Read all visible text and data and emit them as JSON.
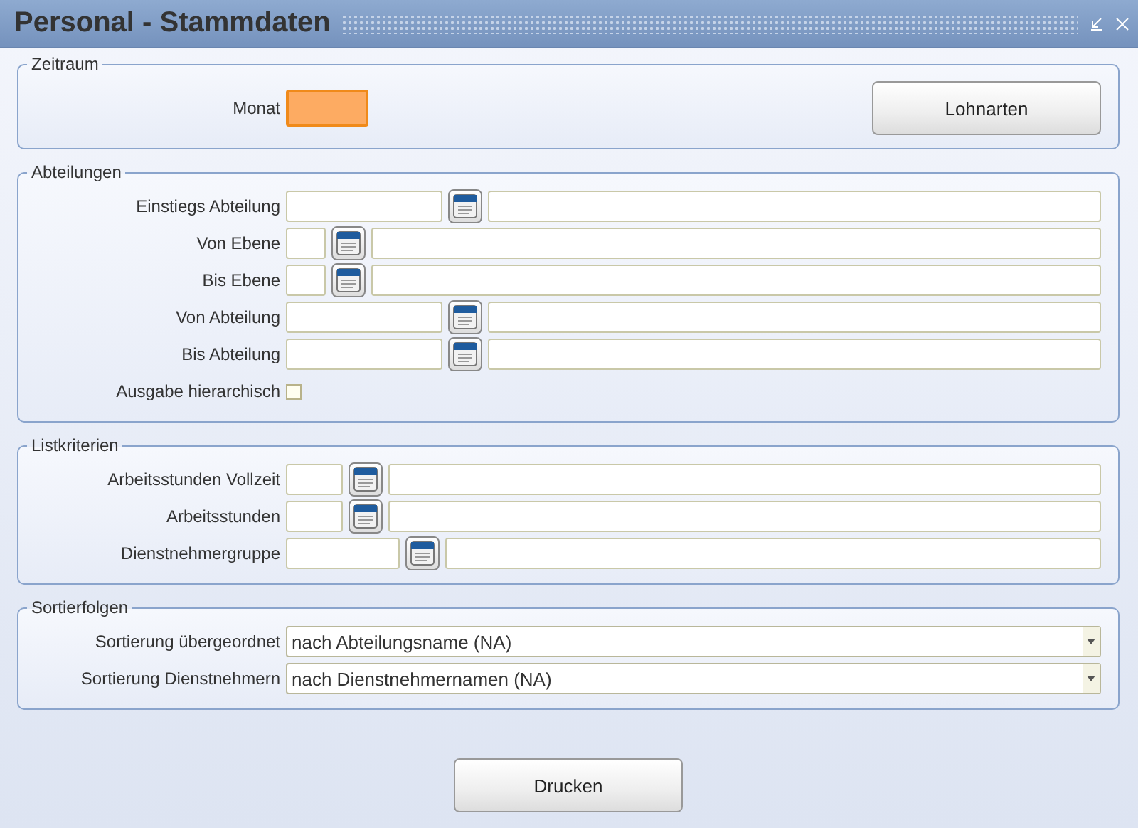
{
  "window": {
    "title": "Personal - Stammdaten"
  },
  "zeitraum": {
    "legend": "Zeitraum",
    "monat": {
      "label": "Monat",
      "focused": true
    },
    "button": "Lohnarten"
  },
  "abteilungen": {
    "legend": "Abteilungen",
    "rows": [
      {
        "label": "Einstiegs Abteilung",
        "kind": "lookup"
      },
      {
        "label": "Von Ebene",
        "kind": "lookup"
      },
      {
        "label": "Bis Ebene",
        "kind": "lookup"
      },
      {
        "label": "Von Abteilung",
        "kind": "lookup"
      },
      {
        "label": "Bis Abteilung",
        "kind": "lookup"
      },
      {
        "label": "Ausgabe hierarchisch",
        "kind": "checkbox",
        "checked": false
      }
    ]
  },
  "listkriterien": {
    "legend": "Listkriterien",
    "rows": [
      {
        "label": "Arbeitsstunden Vollzeit",
        "kind": "lookup"
      },
      {
        "label": "Arbeitsstunden",
        "kind": "lookup"
      },
      {
        "label": "Dienstnehmergruppe",
        "kind": "lookup"
      }
    ]
  },
  "sortierfolgen": {
    "legend": "Sortierfolgen",
    "rows": [
      {
        "label": "Sortierung übergeordnet",
        "value": "nach Abteilungsname (NA)"
      },
      {
        "label": "Sortierung Dienstnehmern",
        "value": "nach Dienstnehmernamen (NA)"
      }
    ]
  },
  "print_button": "Drucken"
}
